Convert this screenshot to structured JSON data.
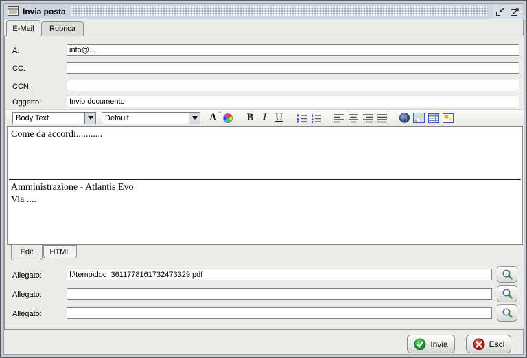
{
  "window": {
    "title": "Invia posta"
  },
  "main_tabs": {
    "email": "E-Mail",
    "rubrica": "Rubrica"
  },
  "recipients": {
    "a_label": "A:",
    "a_value": "info@...",
    "cc_label": "CC:",
    "cc_value": "",
    "ccn_label": "CCN:",
    "ccn_value": "",
    "oggetto_label": "Oggetto:",
    "oggetto_value": "Invio documento"
  },
  "editor": {
    "style_selected": "Body Text",
    "font_selected": "Default",
    "bold": "B",
    "italic": "I",
    "underline": "U",
    "font_letter": "A",
    "font_plus": "+",
    "toolbar_icons": [
      "font-size-icon",
      "text-color-wheel-icon",
      "bold-icon",
      "italic-icon",
      "underline-icon",
      "bulleted-list-icon",
      "numbered-list-icon",
      "align-left-icon",
      "align-center-icon",
      "align-right-icon",
      "justify-icon",
      "globe-link-icon",
      "insert-image-icon",
      "insert-table-icon",
      "insert-object-icon"
    ],
    "body": {
      "line1": "Come da accordi...........",
      "signature1": "Amministrazione - Atlantis Evo",
      "signature2": "Via ...."
    },
    "view_tabs": {
      "edit": "Edit",
      "html": "HTML"
    }
  },
  "attachments": {
    "rows": [
      {
        "label": "Allegato:",
        "value": "f:\\temp\\doc  3611778161732473329.pdf"
      },
      {
        "label": "Allegato:",
        "value": ""
      },
      {
        "label": "Allegato:",
        "value": ""
      }
    ]
  },
  "footer": {
    "send_label": "Invia",
    "exit_label": "Esci"
  },
  "colors": {
    "titlebar": "#ccd5e1",
    "panel": "#ebebe8",
    "accent_green": "#2ba64a",
    "accent_red": "#cf2b2b",
    "icon_blue": "#3c5ba8"
  }
}
